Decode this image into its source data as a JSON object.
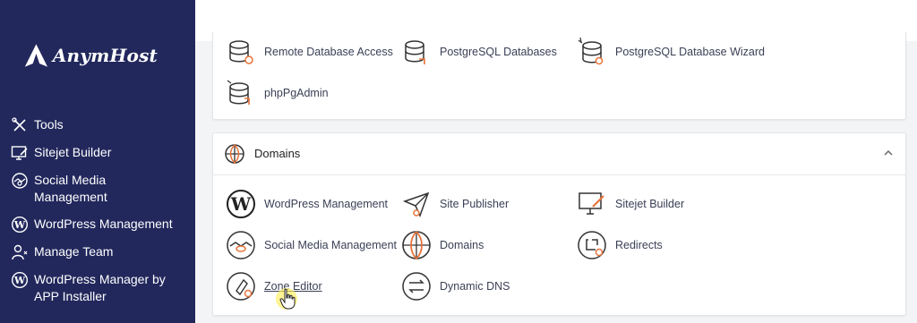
{
  "sidebar": {
    "logo_text": "AnymHost",
    "items": [
      {
        "label": "Tools",
        "icon": "tools-icon"
      },
      {
        "label": "Sitejet Builder",
        "icon": "monitor-pen-icon"
      },
      {
        "label": "Social Media Management",
        "icon": "social-media-icon"
      },
      {
        "label": "WordPress Management",
        "icon": "wordpress-icon"
      },
      {
        "label": "Manage Team",
        "icon": "users-icon"
      },
      {
        "label": "WordPress Manager by APP Installer",
        "icon": "wordpress-icon"
      }
    ]
  },
  "databases": {
    "items": [
      {
        "label": "Remote Database Access",
        "icon": "database-icon"
      },
      {
        "label": "PostgreSQL Databases",
        "icon": "postgresql-database-icon"
      },
      {
        "label": "PostgreSQL Database Wizard",
        "icon": "database-wizard-icon"
      },
      {
        "label": "phpPgAdmin",
        "icon": "phppgadmin-icon"
      }
    ]
  },
  "domains": {
    "title": "Domains",
    "items": [
      {
        "label": "WordPress Management",
        "icon": "wordpress-icon"
      },
      {
        "label": "Site Publisher",
        "icon": "paper-plane-icon"
      },
      {
        "label": "Sitejet Builder",
        "icon": "monitor-pen-icon"
      },
      {
        "label": "Social Media Management",
        "icon": "social-media-icon"
      },
      {
        "label": "Domains",
        "icon": "globe-icon"
      },
      {
        "label": "Redirects",
        "icon": "redirect-icon"
      },
      {
        "label": "Zone Editor",
        "icon": "zone-editor-icon"
      },
      {
        "label": "Dynamic DNS",
        "icon": "dynamic-dns-icon"
      }
    ]
  },
  "colors": {
    "sidebar_bg": "#22285c",
    "accent": "#e8733a",
    "highlight": "#ffec5a"
  }
}
